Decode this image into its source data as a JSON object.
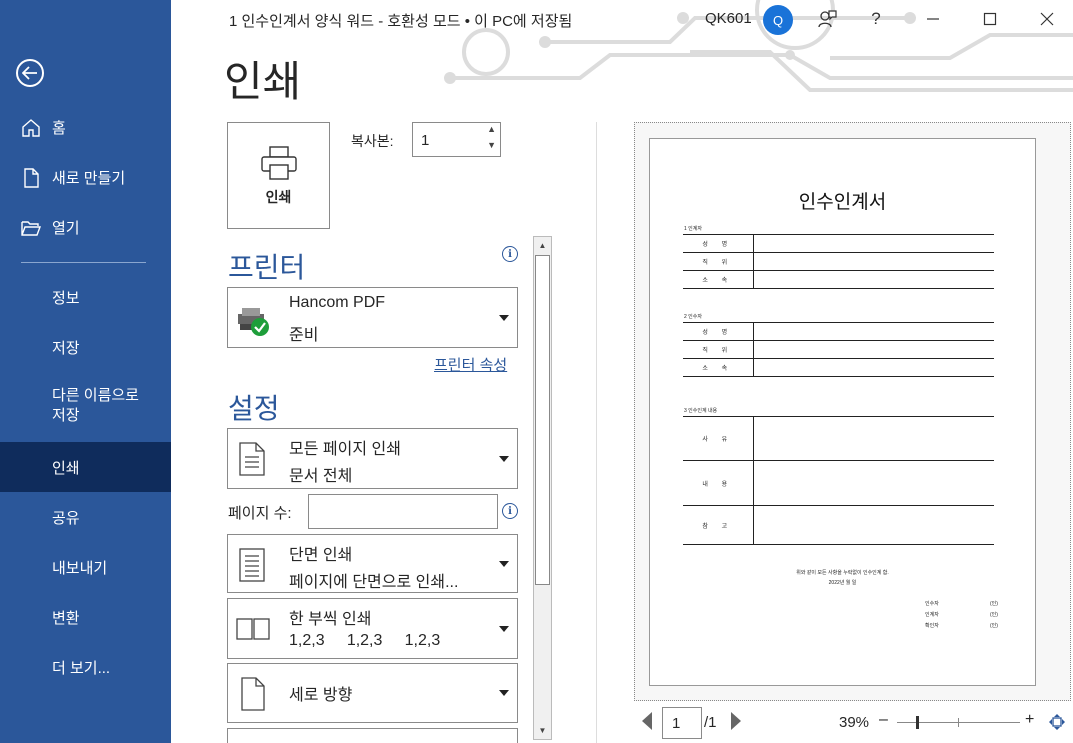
{
  "window": {
    "title": "1 인수인계서 양식 워드  -  호환성 모드 • 이 PC에 저장됨",
    "user": "QK601",
    "avatar_initial": "Q",
    "help": "?"
  },
  "sidebar": {
    "items": [
      {
        "label": "홈",
        "icon": "home-icon"
      },
      {
        "label": "새로 만들기",
        "icon": "new-document-icon"
      },
      {
        "label": "열기",
        "icon": "folder-open-icon"
      },
      {
        "label": "정보"
      },
      {
        "label": "저장"
      },
      {
        "label": "다른 이름으로 저장",
        "line1": "다른 이름으로",
        "line2": "저장"
      },
      {
        "label": "인쇄",
        "active": true
      },
      {
        "label": "공유"
      },
      {
        "label": "내보내기"
      },
      {
        "label": "변환"
      },
      {
        "label": "더 보기..."
      }
    ]
  },
  "print": {
    "page_title": "인쇄",
    "print_button_label": "인쇄",
    "copies_label": "복사본:",
    "copies_value": "1",
    "printer_heading": "프린터",
    "printer": {
      "name": "Hancom PDF",
      "status": "준비"
    },
    "printer_properties": "프린터 속성",
    "settings_heading": "설정",
    "settings": [
      {
        "line1": "모든 페이지 인쇄",
        "line2": "문서 전체"
      },
      {
        "line1": "단면 인쇄",
        "line2": "페이지에 단면으로 인쇄..."
      },
      {
        "line1": "한 부씩 인쇄",
        "line2": "1,2,3     1,2,3     1,2,3"
      },
      {
        "line1": "세로 방향",
        "line2": ""
      }
    ],
    "pages_label": "페이지 수:",
    "pages_value": ""
  },
  "preview": {
    "doc_title": "인수인계서",
    "section1": "1 인계자",
    "section2": "2 인수자",
    "section3": "3 인수인계 내용",
    "rows_person": [
      "성 명",
      "직 위",
      "소 속"
    ],
    "rows_content": [
      "사 유",
      "내 용",
      "참 고"
    ],
    "footer_line1": "위와 같이 모든 사항을 누락없이 인수인계 함.",
    "footer_line2": "2022년  월  일",
    "sign_rows": [
      "인수자",
      "인계자",
      "확인자"
    ],
    "seal": "(인)",
    "current_page": "1",
    "total_pages": "/1",
    "zoom": "39%"
  }
}
